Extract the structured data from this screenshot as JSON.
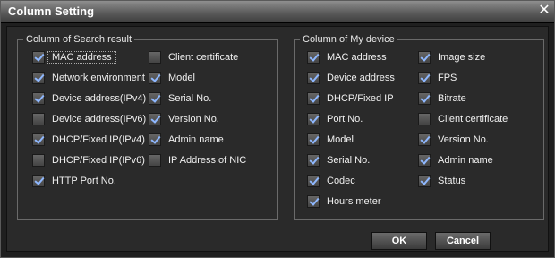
{
  "dialog": {
    "title": "Column Setting"
  },
  "search_result": {
    "legend": "Column of Search result",
    "col1": [
      {
        "label": "MAC address",
        "checked": true
      },
      {
        "label": "Network environment",
        "checked": true
      },
      {
        "label": "Device address(IPv4)",
        "checked": true
      },
      {
        "label": "Device address(IPv6)",
        "checked": false
      },
      {
        "label": "DHCP/Fixed IP(IPv4)",
        "checked": true
      },
      {
        "label": "DHCP/Fixed IP(IPv6)",
        "checked": false
      },
      {
        "label": "HTTP Port No.",
        "checked": true
      }
    ],
    "col2": [
      {
        "label": "Client certificate",
        "checked": false
      },
      {
        "label": "Model",
        "checked": true
      },
      {
        "label": "Serial No.",
        "checked": true
      },
      {
        "label": "Version No.",
        "checked": true
      },
      {
        "label": "Admin name",
        "checked": true
      },
      {
        "label": "IP Address of NIC",
        "checked": false
      }
    ]
  },
  "my_device": {
    "legend": "Column of My device",
    "col1": [
      {
        "label": "MAC address",
        "checked": true
      },
      {
        "label": "Device address",
        "checked": true
      },
      {
        "label": "DHCP/Fixed IP",
        "checked": true
      },
      {
        "label": "Port No.",
        "checked": true
      },
      {
        "label": "Model",
        "checked": true
      },
      {
        "label": "Serial No.",
        "checked": true
      },
      {
        "label": "Codec",
        "checked": true
      },
      {
        "label": "Hours meter",
        "checked": true
      }
    ],
    "col2": [
      {
        "label": "Image size",
        "checked": true
      },
      {
        "label": "FPS",
        "checked": true
      },
      {
        "label": "Bitrate",
        "checked": true
      },
      {
        "label": "Client certificate",
        "checked": false
      },
      {
        "label": "Version No.",
        "checked": true
      },
      {
        "label": "Admin name",
        "checked": true
      },
      {
        "label": "Status",
        "checked": true
      }
    ]
  },
  "buttons": {
    "ok": "OK",
    "cancel": "Cancel"
  },
  "icons": {
    "close": "close-icon",
    "check": "checkmark-icon"
  },
  "colors": {
    "background": "#1f1f1f",
    "title_bar": "#5b5b5b",
    "check_mark": "#8fb8ff",
    "text": "#f0f0f0"
  }
}
